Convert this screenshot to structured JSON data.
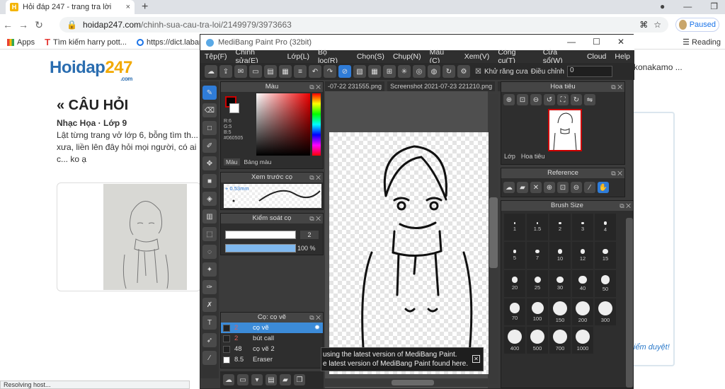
{
  "browser": {
    "tab_title": "Hỏi đáp 247 - trang tra lời",
    "tab_close": "×",
    "new_tab": "+",
    "url_host": "hoidap247.com",
    "url_path": "/chinh-sua-cau-tra-loi/2149979/3973663",
    "profile_status": "Paused",
    "bookmarks": [
      "Apps",
      "Tìm kiếm harry pott...",
      "https://dict.laban.vn"
    ],
    "reading_list": "Reading",
    "status_text": "Resolving host..."
  },
  "page": {
    "logo_main": "Hoidap",
    "logo_num": "247",
    "logo_com": ".com",
    "user_name": "konakamo ...",
    "section_title": "« CÂU HỎI",
    "subject": "Nhạc Họa · Lớp 9",
    "question_text": "Lật từng trang vở lớp 6, bỗng tìm th... xưa, liền lên đây hỏi mọi người, có ai c... ko ạ",
    "right_link": "iểm duyệt!"
  },
  "medibang": {
    "title": "MediBang Paint Pro (32bit)",
    "menu": [
      "Tệp(F)",
      "Chỉnh sửa(E)",
      "Lớp(L)",
      "Bộ lọc(R)",
      "Chọn(S)",
      "Chụp(N)",
      "Màu (C)",
      "Xem(V)",
      "Công cụ(T)",
      "Cửa sổ(W)",
      "Cloud",
      "Help"
    ],
    "antialias_label": "Khử răng cưa",
    "adjust_label": "Điều chỉnh",
    "adjust_value": "0",
    "canvas_tabs": [
      "-07-22 231555.png",
      "Screenshot 2021-07-23 221210.png"
    ],
    "color_panel": {
      "title": "Màu",
      "rgb": "R:6\nG:5\nB:5\n#060505",
      "tabs": [
        "Màu",
        "Bảng màu"
      ],
      "fg": "#060505"
    },
    "preview_panel": {
      "title": "Xem trước cọ",
      "size": "0.53mm"
    },
    "control_panel": {
      "title": "Kiểm soát cọ",
      "size_value": "2",
      "opacity_value": "100 %"
    },
    "brush_panel": {
      "title": "Cọ: cọ vẽ",
      "items": [
        {
          "num": "2",
          "name": "cọ vẽ"
        },
        {
          "num": "2",
          "name": "bút call"
        },
        {
          "num": "48",
          "name": "cọ vẽ 2"
        },
        {
          "num": "8.5",
          "name": "Eraser"
        }
      ]
    },
    "navigator_panel": {
      "title": "Hoa tiêu",
      "tabs": [
        "Lớp",
        "Hoa tiêu"
      ]
    },
    "reference_panel": {
      "title": "Reference"
    },
    "brushsize_panel": {
      "title": "Brush Size",
      "sizes": [
        "1",
        "1.5",
        "2",
        "3",
        "4",
        "5",
        "7",
        "10",
        "12",
        "15",
        "20",
        "25",
        "30",
        "40",
        "50",
        "70",
        "100",
        "150",
        "200",
        "300",
        "400",
        "500",
        "700",
        "1000"
      ]
    },
    "notification": "using the latest version of MediBang Paint.\ne latest version of MediBang Paint found here."
  }
}
